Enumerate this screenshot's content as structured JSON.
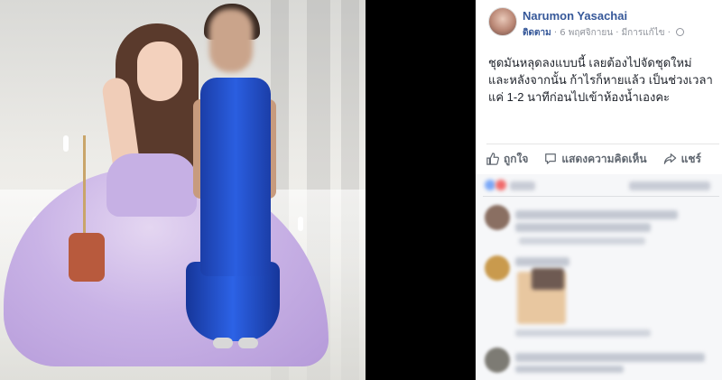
{
  "post": {
    "author": "Narumon Yasachai",
    "follow_label": "ติดตาม",
    "date": "6 พฤศจิกายน",
    "edited_label": "มีการแก้ไข",
    "separator": "·",
    "text": "ชุดมันหลุดลงแบบนี้ เลยต้องไปจัดชุดใหม่ และหลังจากนั้น ก้าไรก็หายแล้ว เป็นช่วงเวลาแค่ 1-2 นาทีก่อนไปเข้าห้องน้ำเองคะ"
  },
  "actions": {
    "like_label": "ถูกใจ",
    "comment_label": "แสดงความคิดเห็น",
    "share_label": "แชร์"
  },
  "icons": {
    "avatar": "profile-photo",
    "globe": "globe-icon",
    "like": "thumbs-up-icon",
    "comment": "speech-bubble-icon",
    "share": "share-arrow-icon"
  },
  "colors": {
    "link": "#365899",
    "meta": "#90949c",
    "text": "#1d2129",
    "action": "#606770",
    "comments_bg": "#f6f7f9"
  }
}
